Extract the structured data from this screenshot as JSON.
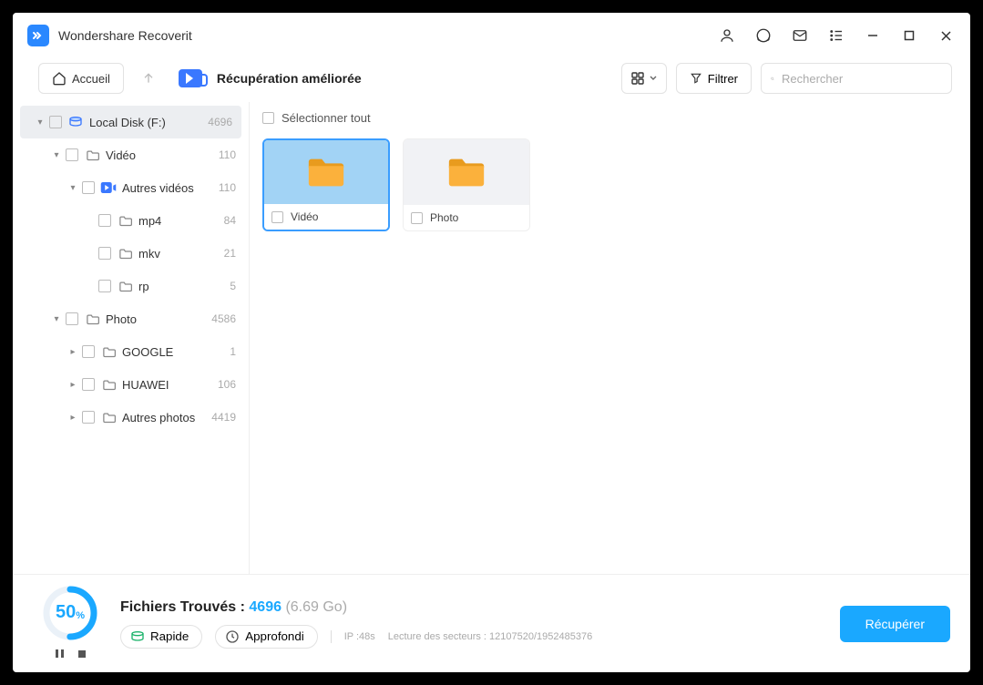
{
  "app": {
    "title": "Wondershare Recoverit"
  },
  "toolbar": {
    "home": "Accueil",
    "page_title": "Récupération améliorée",
    "filter": "Filtrer",
    "search_placeholder": "Rechercher"
  },
  "tree": [
    {
      "label": "Local Disk (F:)",
      "count": "4696",
      "depth": 0,
      "icon": "disk",
      "expanded": true,
      "selected": true
    },
    {
      "label": "Vidéo",
      "count": "110",
      "depth": 1,
      "icon": "folder",
      "expanded": true
    },
    {
      "label": "Autres vidéos",
      "count": "110",
      "depth": 2,
      "icon": "video",
      "expanded": true
    },
    {
      "label": "mp4",
      "count": "84",
      "depth": 3,
      "icon": "folder",
      "expanded": null
    },
    {
      "label": "mkv",
      "count": "21",
      "depth": 3,
      "icon": "folder",
      "expanded": null
    },
    {
      "label": "rp",
      "count": "5",
      "depth": 3,
      "icon": "folder",
      "expanded": null
    },
    {
      "label": "Photo",
      "count": "4586",
      "depth": 1,
      "icon": "folder",
      "expanded": true
    },
    {
      "label": "GOOGLE",
      "count": "1",
      "depth": 2,
      "icon": "folder",
      "expanded": false
    },
    {
      "label": "HUAWEI",
      "count": "106",
      "depth": 2,
      "icon": "folder",
      "expanded": false
    },
    {
      "label": "Autres photos",
      "count": "4419",
      "depth": 2,
      "icon": "folder",
      "expanded": false
    }
  ],
  "content": {
    "select_all": "Sélectionner tout",
    "folders": [
      {
        "name": "Vidéo",
        "selected": true
      },
      {
        "name": "Photo",
        "selected": false
      }
    ]
  },
  "footer": {
    "progress_value": "50",
    "progress_unit": "%",
    "found_label": "Fichiers Trouvés : ",
    "found_count": "4696",
    "found_size": "(6.69 Go)",
    "mode_fast": "Rapide",
    "mode_deep": "Approfondi",
    "ip_status": "IP :48s",
    "sector_status": "Lecture des secteurs : 12107520/1952485376",
    "recover": "Récupérer"
  }
}
